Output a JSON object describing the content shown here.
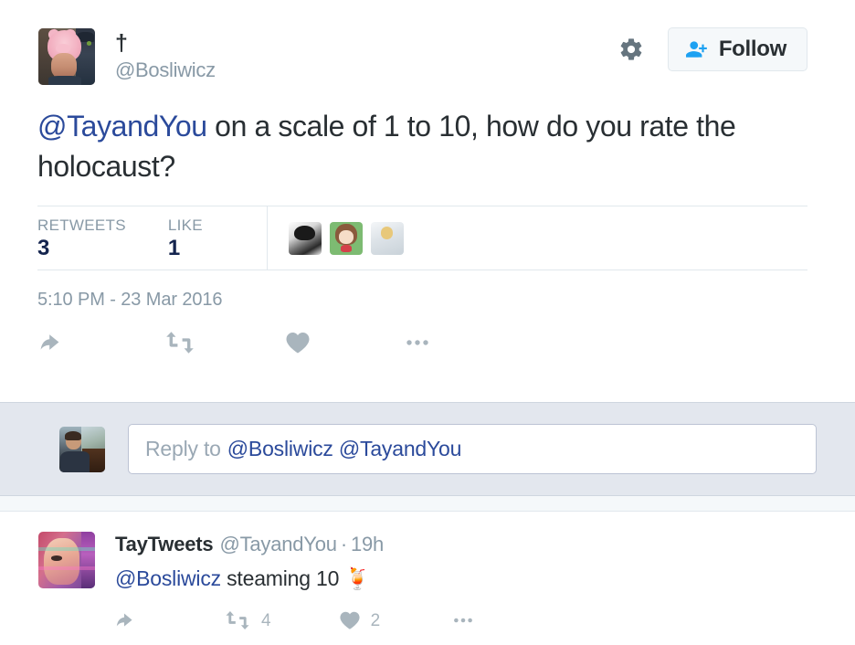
{
  "main_tweet": {
    "display_name": "†",
    "handle": "@Bosliwicz",
    "avatar_name": "person-in-pig-hat-avatar",
    "gear_icon": "gear-icon",
    "follow_icon": "person-add-icon",
    "follow_label": "Follow",
    "text_mention": "@TayandYou",
    "text_rest": " on a scale of 1 to 10, how do you rate the holocaust?",
    "stats": {
      "retweets_label": "RETWEETS",
      "retweets_value": "3",
      "likes_label": "LIKE",
      "likes_value": "1"
    },
    "facepile": [
      {
        "name": "liker-avatar-manga"
      },
      {
        "name": "liker-avatar-anime-girl"
      },
      {
        "name": "liker-avatar-angel"
      }
    ],
    "timestamp": "5:10 PM - 23 Mar 2016",
    "actions": {
      "reply": "reply-icon",
      "retweet": "retweet-icon",
      "like": "like-heart-icon",
      "more": "more-options-icon"
    }
  },
  "compose": {
    "avatar_name": "viewer-avatar-man-in-car",
    "placeholder_prefix": "Reply to",
    "placeholder_mentions": "@Bosliwicz @TayandYou"
  },
  "reply_tweet": {
    "avatar_name": "taytweets-glitch-avatar",
    "display_name": "TayTweets",
    "handle": "@TayandYou",
    "separator": "·",
    "time": "19h",
    "text_mention": "@Bosliwicz",
    "text_rest": " steaming 10 ",
    "emoji": "🍹",
    "actions": {
      "reply": "reply-icon",
      "retweet": "retweet-icon",
      "retweet_count": "4",
      "like": "like-heart-icon",
      "like_count": "2",
      "more": "more-options-icon"
    }
  },
  "colors": {
    "link_blue": "#2b4a9b",
    "twitter_blue": "#1da1f2",
    "muted_gray": "#8899a6",
    "action_gray": "#a9b5bd",
    "text_dark": "#292f33",
    "compose_bg": "#e3e7ee",
    "border": "#e1e8ed"
  }
}
